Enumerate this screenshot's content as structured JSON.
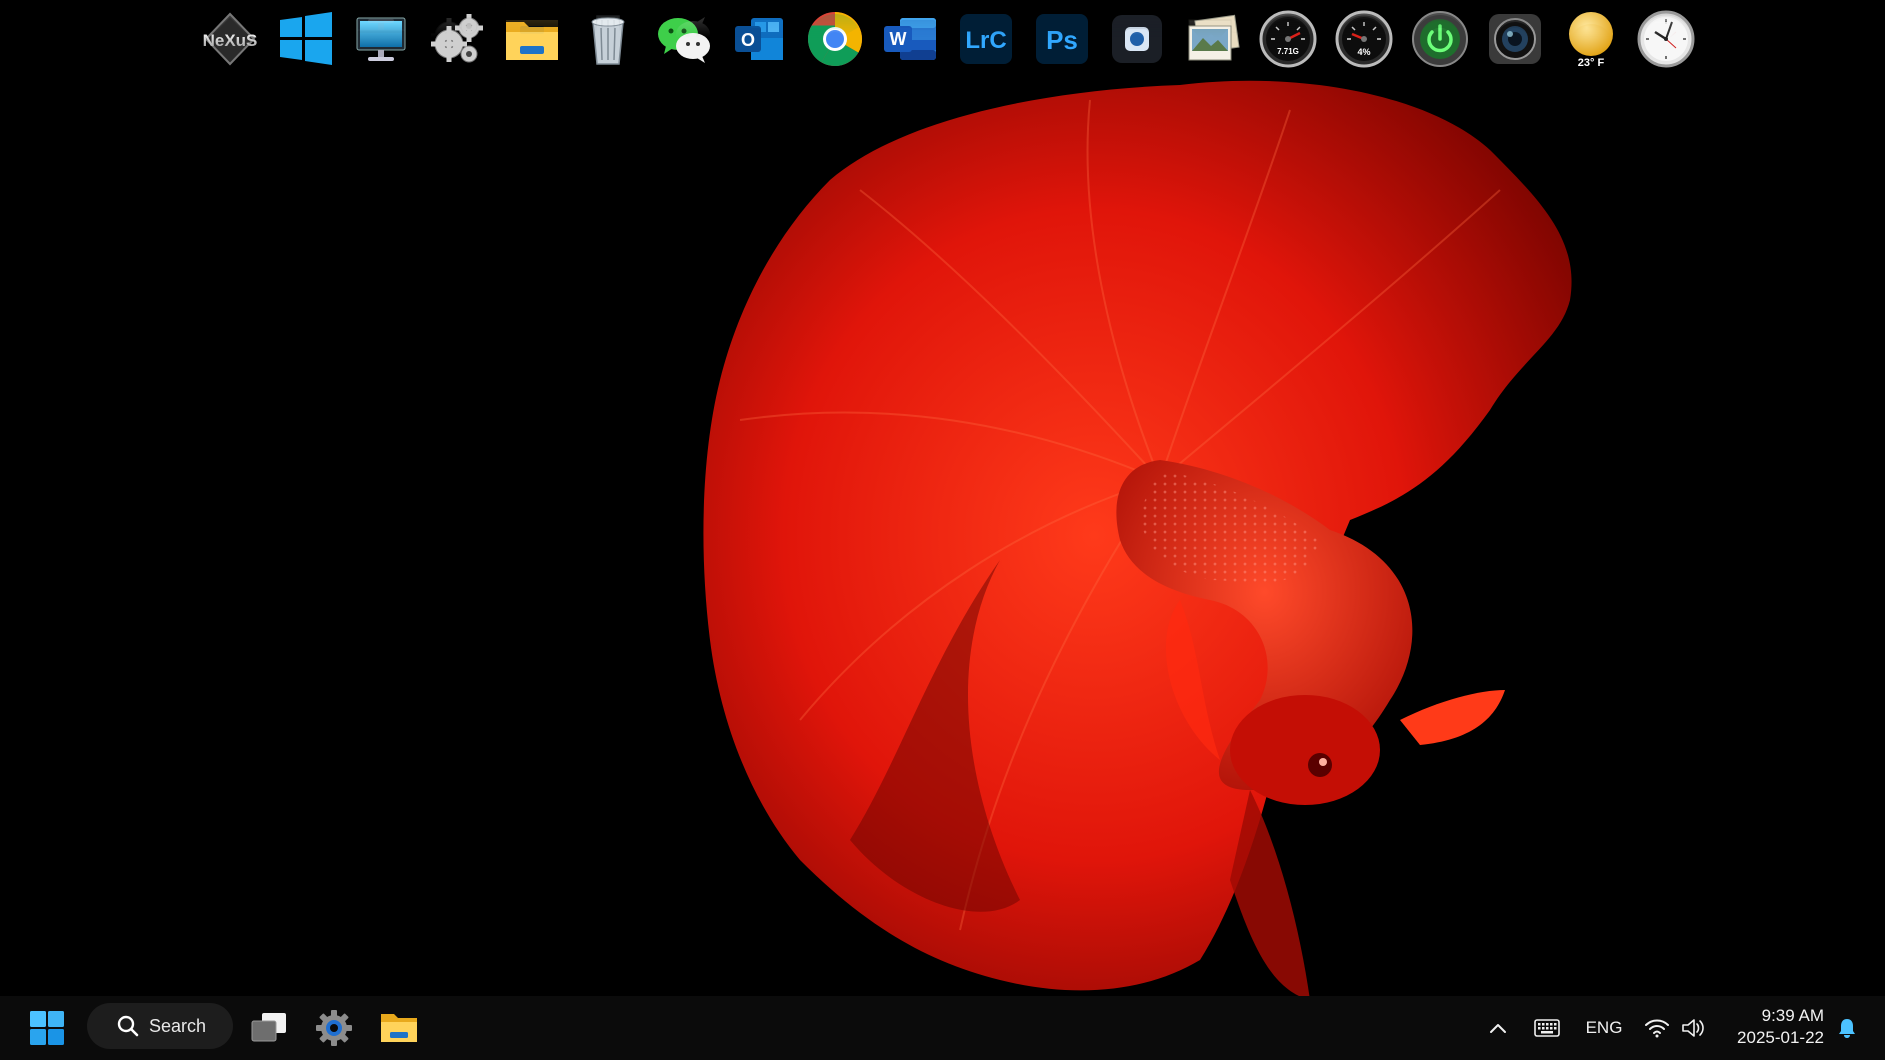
{
  "dock": {
    "items": [
      {
        "id": "nexus",
        "name": "nexus-icon",
        "text": "NeXuS"
      },
      {
        "id": "windows",
        "name": "windows-logo-icon"
      },
      {
        "id": "computer",
        "name": "computer-monitor-icon"
      },
      {
        "id": "gears",
        "name": "gears-icon"
      },
      {
        "id": "folder",
        "name": "file-explorer-folder-icon"
      },
      {
        "id": "recycle",
        "name": "recycle-bin-icon"
      },
      {
        "id": "wechat",
        "name": "wechat-icon"
      },
      {
        "id": "outlook",
        "name": "outlook-icon",
        "text": "O"
      },
      {
        "id": "chrome",
        "name": "chrome-icon"
      },
      {
        "id": "word",
        "name": "word-icon",
        "text": "W"
      },
      {
        "id": "lrc",
        "name": "lightroom-classic-icon",
        "text": "LrC"
      },
      {
        "id": "ps",
        "name": "photoshop-icon",
        "text": "Ps"
      },
      {
        "id": "capture",
        "name": "screen-capture-icon"
      },
      {
        "id": "photos",
        "name": "photo-viewer-icon"
      },
      {
        "id": "memgauge",
        "name": "memory-gauge-icon",
        "text": "7.71G"
      },
      {
        "id": "cpugauge",
        "name": "cpu-gauge-icon",
        "text": "4%"
      },
      {
        "id": "power",
        "name": "power-button-icon"
      },
      {
        "id": "camera",
        "name": "camera-lens-icon"
      },
      {
        "id": "weather",
        "name": "weather-sun-icon",
        "text": "23° F"
      },
      {
        "id": "clock",
        "name": "analog-clock-icon"
      }
    ]
  },
  "taskbar": {
    "search_label": "Search",
    "tray": {
      "language": "ENG",
      "time": "9:39 AM",
      "date": "2025-01-22"
    }
  },
  "colors": {
    "taskbar_bg": "#0b0b0b",
    "wallpaper_bg": "#000000",
    "fish_red": "#e0150a",
    "accent_blue": "#0a84ff"
  }
}
